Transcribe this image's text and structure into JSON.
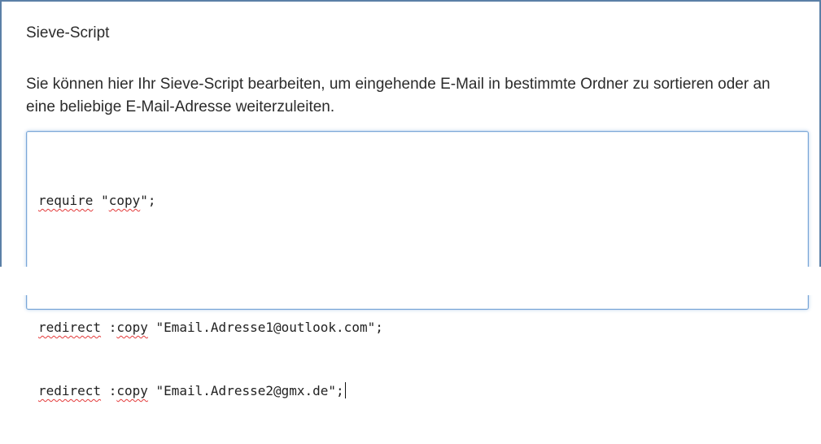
{
  "section": {
    "title": "Sieve-Script",
    "description": "Sie können hier Ihr Sieve-Script bearbeiten, um eingehende E-Mail in bestimmte Ordner zu sortieren oder an eine beliebige E-Mail-Adresse weiterzuleiten."
  },
  "editor": {
    "lines": [
      {
        "kw": "require",
        "sp1": " ",
        "arg": "\"copy\";"
      },
      {},
      {
        "kw": "redirect",
        "sp1": " :",
        "tag": "copy",
        "rest": " \"Email.Adresse1@outlook.com\";"
      },
      {
        "kw": "redirect",
        "sp1": " :",
        "tag": "copy",
        "rest": " \"Email.Adresse2@gmx.de\";"
      }
    ]
  },
  "colors": {
    "frame_border": "#5b7fa6",
    "editor_border": "#7aa7d8",
    "spellcheck_underline": "#e33a3a"
  }
}
